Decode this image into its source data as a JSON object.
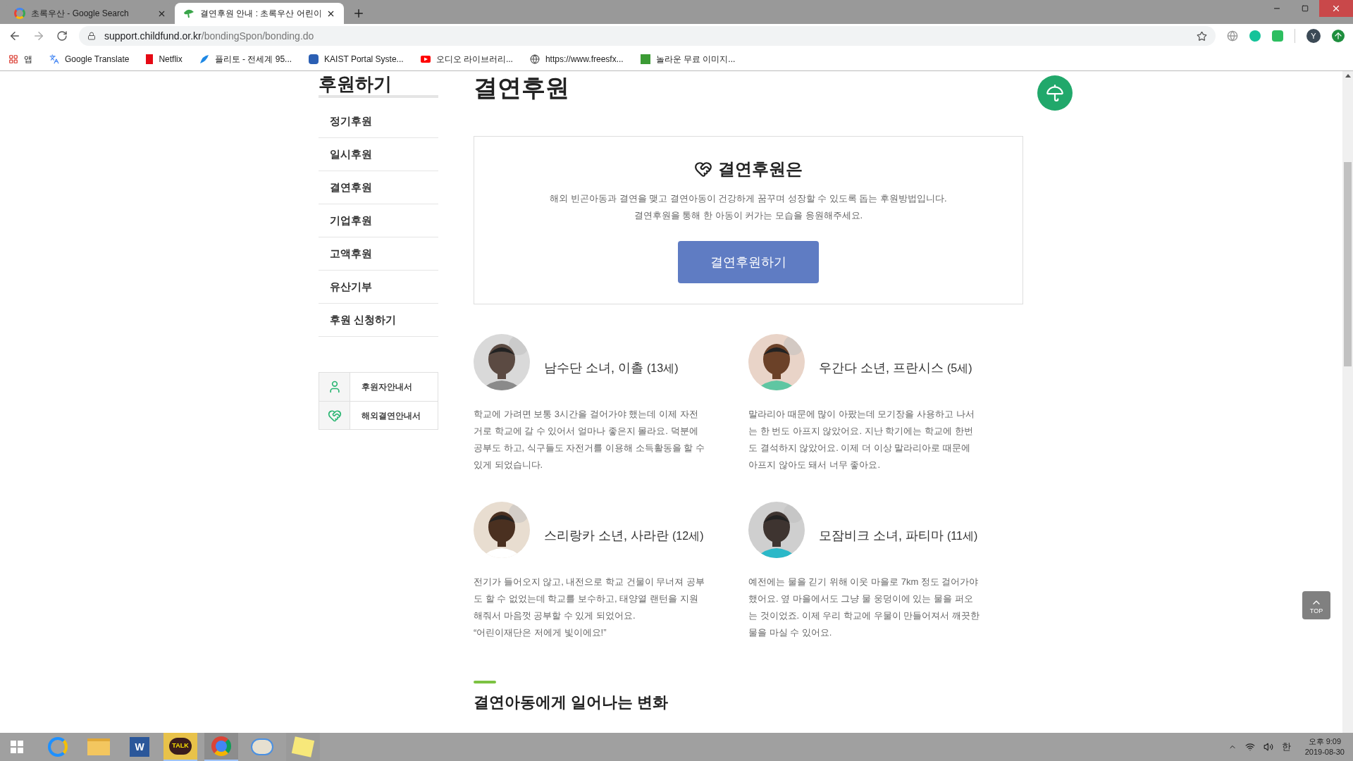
{
  "browser": {
    "tabs": [
      {
        "title": "초록우산 - Google Search",
        "kind": "google",
        "selected": false
      },
      {
        "title": "결연후원 안내 : 초록우산 어린이",
        "kind": "leaf",
        "selected": true
      }
    ],
    "url": {
      "host": "support.childfund.or.kr",
      "path": "/bondingSpon/bonding.do"
    },
    "bookmarks": [
      {
        "label": "앱",
        "kind": "apps"
      },
      {
        "label": "Google Translate",
        "kind": "translate"
      },
      {
        "label": "Netflix",
        "kind": "netflix"
      },
      {
        "label": "플리토 - 전세계 95...",
        "kind": "flitto"
      },
      {
        "label": "KAIST Portal Syste...",
        "kind": "kaist"
      },
      {
        "label": "오디오 라이브러리...",
        "kind": "youtube"
      },
      {
        "label": "https://www.freesfx...",
        "kind": "globe"
      },
      {
        "label": "놀라운 무료 이미지...",
        "kind": "px"
      }
    ],
    "profile": "Y"
  },
  "sidebar": {
    "heading": "후원하기",
    "items": [
      {
        "label": "정기후원"
      },
      {
        "label": "일시후원"
      },
      {
        "label": "결연후원"
      },
      {
        "label": "기업후원"
      },
      {
        "label": "고액후원"
      },
      {
        "label": "유산기부"
      },
      {
        "label": "후원 신청하기"
      }
    ],
    "guides": [
      {
        "label": "후원자안내서",
        "kind": "person"
      },
      {
        "label": "해외결연안내서",
        "kind": "heart"
      }
    ]
  },
  "main": {
    "heading": "결연후원",
    "intro": {
      "title": "결연후원은",
      "lines": [
        "해외 빈곤아동과 결연을 맺고 결연아동이 건강하게 꿈꾸며 성장할 수 있도록 돕는 후원방법입니다.",
        "결연후원을 통해 한 아동이 커가는 모습을 응원해주세요."
      ],
      "button": "결연후원하기"
    },
    "stories": [
      {
        "name": "남수단 소녀, 이촐",
        "age": "(13세)",
        "lines": [
          "학교에 가려면 보통 3시간을 걸어가야 했는데 이제 자전",
          "거로 학교에 갈 수 있어서 얼마나 좋은지 몰라요. 덕분에",
          "공부도 하고, 식구들도 자전거를 이용해 소득활동을 할 수",
          "있게 되었습니다."
        ]
      },
      {
        "name": "우간다 소년, 프란시스",
        "age": "(5세)",
        "lines": [
          "말라리아 때문에 많이 아팠는데 모기장을 사용하고 나서",
          "는 한 번도 아프지 않았어요. 지난 학기에는 학교에 한번",
          "도 결석하지 않았어요. 이제 더 이상 말라리아로 때문에",
          "아프지 않아도 돼서 너무 좋아요."
        ]
      },
      {
        "name": "스리랑카 소년, 사라란",
        "age": "(12세)",
        "lines": [
          "전기가 들어오지 않고, 내전으로 학교 건물이 무너져 공부",
          "도 할 수 없었는데 학교를 보수하고, 태양열 랜턴을 지원",
          "해줘서 마음껏 공부할 수 있게 되었어요.",
          "“어린이재단은 저에게 빛이에요!”"
        ]
      },
      {
        "name": "모잠비크 소녀, 파티마",
        "age": "(11세)",
        "lines": [
          "예전에는 물을 긷기 위해 이웃 마을로 7km 정도 걸어가야",
          "했어요. 옆 마을에서도 그냥 물 웅덩이에 있는 물을 퍼오",
          "는 것이었죠. 이제 우리 학교에 우물이 만들어져서 깨끗한",
          "물을 마실 수 있어요."
        ]
      }
    ],
    "section_title": "결연아동에게 일어나는 변화"
  },
  "top_button": "TOP",
  "taskbar": {
    "apps": [
      {
        "kind": "ie"
      },
      {
        "kind": "folder"
      },
      {
        "kind": "word",
        "label": "W"
      },
      {
        "kind": "kakao",
        "label": "TALK"
      },
      {
        "kind": "chrome"
      },
      {
        "kind": "paint"
      },
      {
        "kind": "notes"
      }
    ],
    "ime": "한",
    "time": "오후 9:09",
    "date": "2019-08-30"
  }
}
